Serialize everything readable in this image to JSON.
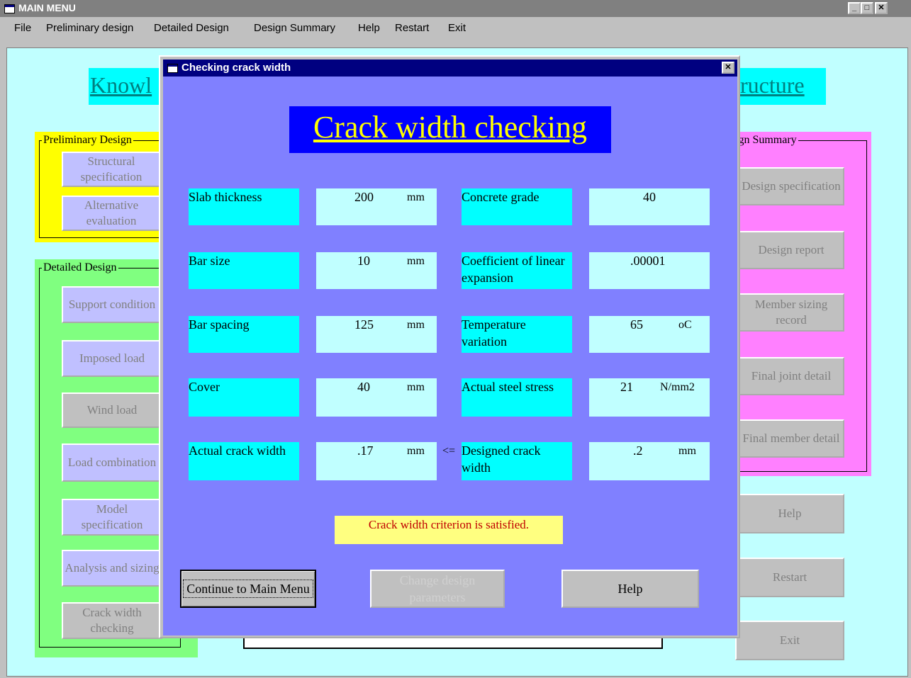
{
  "main_window": {
    "title": "MAIN MENU",
    "caption_buttons": [
      "_",
      "□",
      "✕"
    ],
    "menu": [
      "File",
      "Preliminary design",
      "Detailed Design",
      "Design Summary",
      "Help",
      "Restart",
      "Exit"
    ],
    "banner_left": "Knowl",
    "banner_right": "ructure",
    "preliminary": {
      "label": "Preliminary Design",
      "buttons": [
        "Structural specification",
        "Alternative evaluation"
      ]
    },
    "detailed": {
      "label": "Detailed Design",
      "buttons": [
        "Support condition",
        "Imposed load",
        "Wind load",
        "Load combination",
        "Model specification",
        "Analysis and sizing",
        "Crack width checking"
      ]
    },
    "summary": {
      "label": "ign Summary",
      "buttons": [
        "Design specification",
        "Design report",
        "Member sizing record",
        "Final joint detail",
        "Final member detail"
      ]
    },
    "right_buttons": [
      "Help",
      "Restart",
      "Exit"
    ]
  },
  "dialog": {
    "title": "Checking crack width",
    "close": "✕",
    "heading": "Crack width checking",
    "left_fields": [
      {
        "label": "Slab thickness",
        "value": "200",
        "unit": "mm"
      },
      {
        "label": "Bar size",
        "value": "10",
        "unit": "mm"
      },
      {
        "label": "Bar spacing",
        "value": "125",
        "unit": "mm"
      },
      {
        "label": "Cover",
        "value": "40",
        "unit": "mm"
      },
      {
        "label": "Actual crack width",
        "value": ".17",
        "unit": "mm"
      }
    ],
    "right_fields": [
      {
        "label": "Concrete grade",
        "value": "40",
        "unit": ""
      },
      {
        "label": "Coefficient of linear expansion",
        "value": ".00001",
        "unit": ""
      },
      {
        "label": "Temperature variation",
        "value": "65",
        "unit": "oC"
      },
      {
        "label": "Actual steel stress",
        "value": "21",
        "unit": "N/mm2"
      },
      {
        "label": "Designed crack width",
        "value": ".2",
        "unit": "mm"
      }
    ],
    "comparison": "<=",
    "message": "Crack width criterion is satisfied.",
    "buttons": {
      "continue": "Continue to Main Menu",
      "change": "Change design parameters",
      "help": "Help"
    }
  },
  "colors": {
    "dialog_body": "#8080ff",
    "heading_bg": "#0000ff",
    "heading_text": "#ffff00",
    "label_bg": "#00ffff",
    "value_bg": "#c0ffff",
    "message_bg": "#ffff80",
    "message_text": "#c00000"
  }
}
